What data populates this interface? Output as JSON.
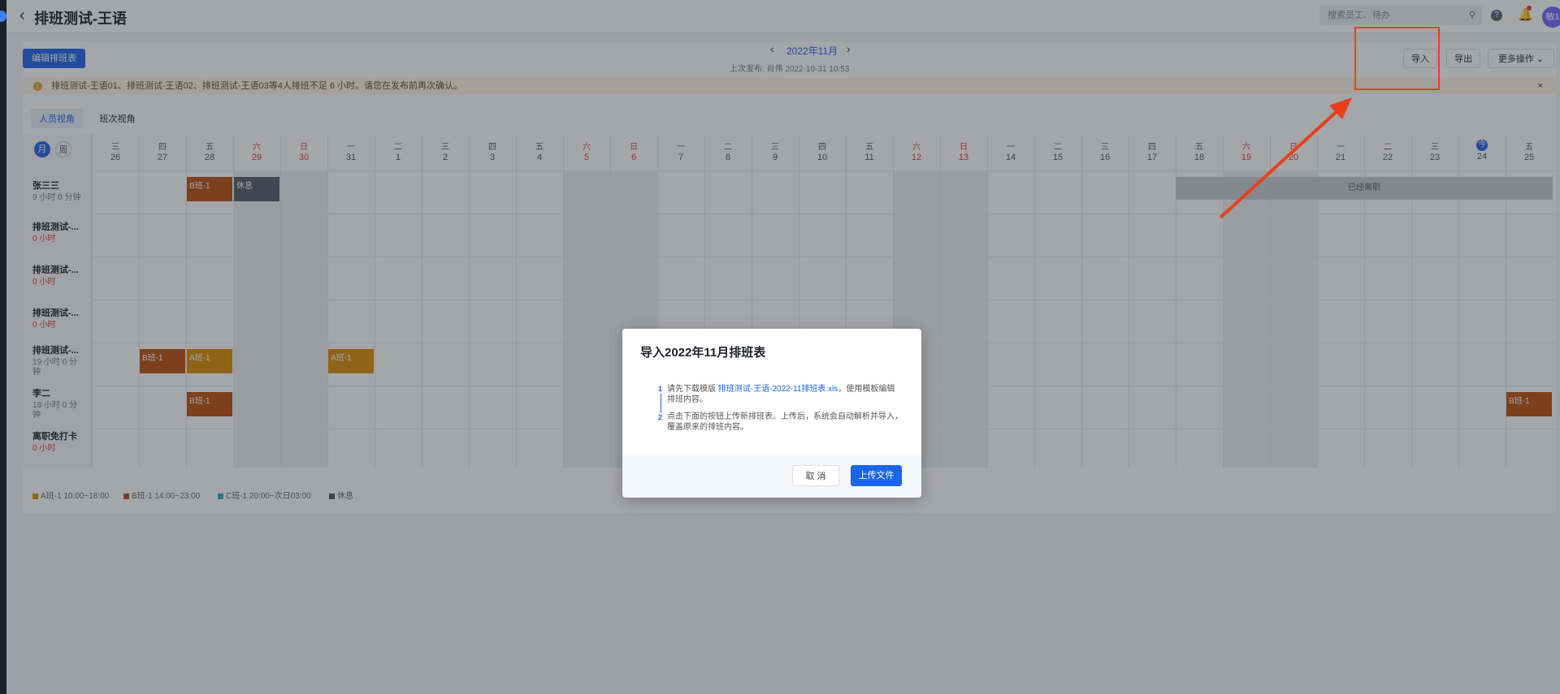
{
  "header": {
    "back_icon": "‹",
    "title": "排班测试-王语",
    "search_placeholder": "搜索员工、待办",
    "help_label": "?",
    "avatar_text": "敏1"
  },
  "toolbar": {
    "edit_label": "编辑排班表",
    "month": "2022年11月",
    "last_publish": "上次发布: 肖伟 2022-10-31 10:53",
    "import_label": "导入",
    "export_label": "导出",
    "more_label": "更多操作"
  },
  "notice": {
    "text": "排班测试-王语01、排班测试-王语02、排班测试-王语03等4人排班不足 6 小时。请您在发布前再次确认。",
    "close": "×"
  },
  "view_tabs": [
    "人员视角",
    "班次视角"
  ],
  "mode_toggle": {
    "month": "月",
    "week": "周"
  },
  "days": [
    {
      "w": "三",
      "d": "26",
      "red": false
    },
    {
      "w": "四",
      "d": "27",
      "red": false
    },
    {
      "w": "五",
      "d": "28",
      "red": false
    },
    {
      "w": "六",
      "d": "29",
      "red": true
    },
    {
      "w": "日",
      "d": "30",
      "red": true
    },
    {
      "w": "一",
      "d": "31",
      "red": false
    },
    {
      "w": "二",
      "d": "1",
      "red": false
    },
    {
      "w": "三",
      "d": "2",
      "red": false
    },
    {
      "w": "四",
      "d": "3",
      "red": false
    },
    {
      "w": "五",
      "d": "4",
      "red": false
    },
    {
      "w": "六",
      "d": "5",
      "red": true
    },
    {
      "w": "日",
      "d": "6",
      "red": true
    },
    {
      "w": "一",
      "d": "7",
      "red": false
    },
    {
      "w": "二",
      "d": "8",
      "red": false
    },
    {
      "w": "三",
      "d": "9",
      "red": false
    },
    {
      "w": "四",
      "d": "10",
      "red": false
    },
    {
      "w": "五",
      "d": "11",
      "red": false
    },
    {
      "w": "六",
      "d": "12",
      "red": true
    },
    {
      "w": "日",
      "d": "13",
      "red": true
    },
    {
      "w": "一",
      "d": "14",
      "red": false
    },
    {
      "w": "二",
      "d": "15",
      "red": false
    },
    {
      "w": "三",
      "d": "16",
      "red": false
    },
    {
      "w": "四",
      "d": "17",
      "red": false
    },
    {
      "w": "五",
      "d": "18",
      "red": false
    },
    {
      "w": "六",
      "d": "19",
      "red": true
    },
    {
      "w": "日",
      "d": "20",
      "red": true
    },
    {
      "w": "一",
      "d": "21",
      "red": false
    },
    {
      "w": "二",
      "d": "22",
      "red": false
    },
    {
      "w": "三",
      "d": "23",
      "red": false
    },
    {
      "w": "今",
      "d": "24",
      "red": false
    },
    {
      "w": "五",
      "d": "25",
      "red": false
    }
  ],
  "people": [
    {
      "name": "张三三",
      "hours": "9 小时 0 分钟",
      "hours_red": false
    },
    {
      "name": "排班测试-...",
      "hours": "0 小时",
      "hours_red": true
    },
    {
      "name": "排班测试-...",
      "hours": "0 小时",
      "hours_red": true
    },
    {
      "name": "排班测试-...",
      "hours": "0 小时",
      "hours_red": true
    },
    {
      "name": "排班测试-...",
      "hours": "19 小时 0 分钟",
      "hours_red": false
    },
    {
      "name": "李二",
      "hours": "18 小时 0 分钟",
      "hours_red": false
    },
    {
      "name": "离职免打卡",
      "hours": "0 小时",
      "hours_red": true
    }
  ],
  "shifts": [
    {
      "row": 0,
      "day": 2,
      "label": "B班-1",
      "type": "B"
    },
    {
      "row": 0,
      "day": 3,
      "label": "休息",
      "type": "R"
    },
    {
      "row": 4,
      "day": 1,
      "label": "B班-1",
      "type": "B"
    },
    {
      "row": 4,
      "day": 2,
      "label": "A班-1",
      "type": "A"
    },
    {
      "row": 4,
      "day": 5,
      "label": "A班-1",
      "type": "A"
    },
    {
      "row": 5,
      "day": 2,
      "label": "B班-1",
      "type": "B"
    },
    {
      "row": 5,
      "day": 30,
      "label": "B班-1",
      "type": "B"
    }
  ],
  "leave_text": "已经离职",
  "legend": [
    {
      "label": "A班-1 10:00~18:00",
      "color": "#d98e04"
    },
    {
      "label": "B班-1 14:00~23:00",
      "color": "#b8500d"
    },
    {
      "label": "C班-1 20:00~次日03:00",
      "color": "#3aa6c9"
    },
    {
      "label": "休息",
      "color": "#555b66"
    }
  ],
  "colors": {
    "A": "#d98e04",
    "B": "#b8500d",
    "R": "#555b66"
  },
  "modal": {
    "title": "导入2022年11月排班表",
    "step1_num": "1",
    "step1_pre": "请先下载模版 ",
    "step1_link": "排班测试-王语-2022-11排班表.xls",
    "step1_post": "，使用模板编辑排班内容。",
    "step2_num": "2",
    "step2_text": "点击下面的按钮上传新排班表。上传后，系统会自动解析并导入，覆盖原来的排班内容。",
    "cancel": "取 消",
    "upload": "上传文件"
  }
}
